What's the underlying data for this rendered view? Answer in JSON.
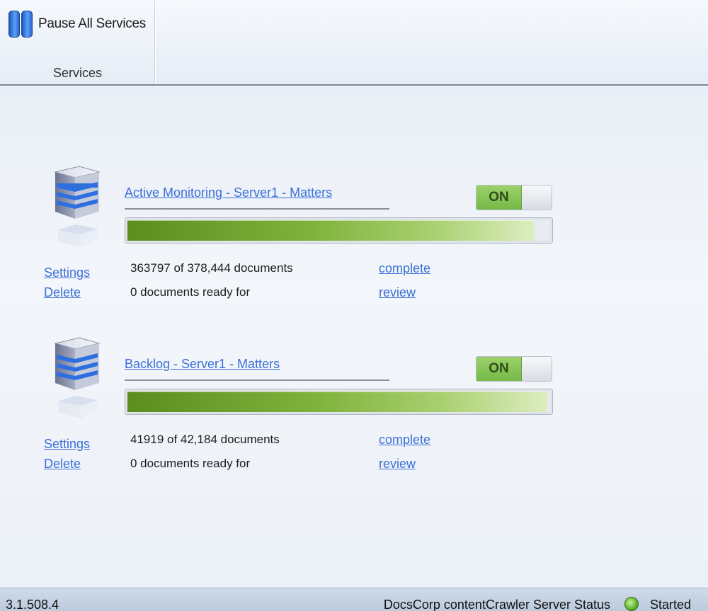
{
  "toolbar": {
    "pause_all_label": "Pause All Services",
    "group_label": "Services"
  },
  "services": [
    {
      "title": "Active Monitoring - Server1 - Matters",
      "toggle_label": "ON",
      "progress_fraction": 0.961,
      "settings_label": "Settings",
      "delete_label": "Delete",
      "documents_text": "363797 of 378,444 documents",
      "ready_text": "0 documents ready for",
      "complete_link": "complete",
      "review_link": "review"
    },
    {
      "title": "Backlog - Server1 - Matters",
      "toggle_label": "ON",
      "progress_fraction": 0.994,
      "settings_label": "Settings",
      "delete_label": "Delete",
      "documents_text": "41919 of 42,184 documents",
      "ready_text": "0 documents ready for",
      "complete_link": "complete",
      "review_link": "review"
    }
  ],
  "statusbar": {
    "version": "3.1.508.4",
    "status_label": "DocsCorp contentCrawler Server Status",
    "status_value": "Started",
    "status_color": "#5db12a"
  },
  "colors": {
    "link": "#3a6fd8",
    "toggle_on": "#76b948",
    "progress": "#7fb23c"
  }
}
